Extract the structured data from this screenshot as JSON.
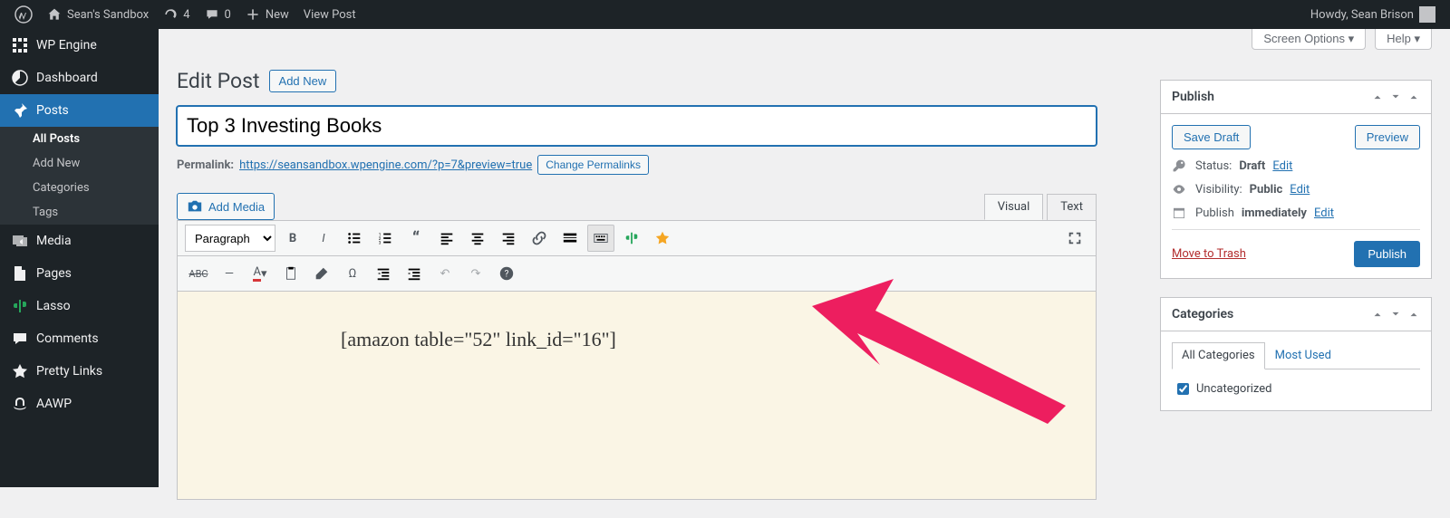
{
  "topbar": {
    "site_name": "Sean's Sandbox",
    "updates_count": "4",
    "comments_count": "0",
    "new_label": "New",
    "view_post_label": "View Post",
    "greeting": "Howdy, Sean Brison"
  },
  "sidebar": {
    "items": [
      {
        "label": "WP Engine",
        "icon": "wpengine-icon"
      },
      {
        "label": "Dashboard",
        "icon": "dashboard-icon"
      },
      {
        "label": "Posts",
        "icon": "pin-icon",
        "active": true
      },
      {
        "label": "Media",
        "icon": "media-icon"
      },
      {
        "label": "Pages",
        "icon": "pages-icon"
      },
      {
        "label": "Lasso",
        "icon": "cactus-icon"
      },
      {
        "label": "Comments",
        "icon": "comment-icon"
      },
      {
        "label": "Pretty Links",
        "icon": "star-icon"
      },
      {
        "label": "AAWP",
        "icon": "amazon-icon"
      }
    ],
    "submenu": [
      {
        "label": "All Posts",
        "active": true
      },
      {
        "label": "Add New"
      },
      {
        "label": "Categories"
      },
      {
        "label": "Tags"
      }
    ]
  },
  "screen_meta": {
    "screen_options_label": "Screen Options",
    "help_label": "Help"
  },
  "heading": {
    "title": "Edit Post",
    "add_new_label": "Add New"
  },
  "post_title": {
    "value": "Top 3 Investing Books"
  },
  "permalink": {
    "label": "Permalink:",
    "url": "https://seansandbox.wpengine.com/?p=7&preview=true",
    "change_label": "Change Permalinks"
  },
  "editor": {
    "add_media_label": "Add Media",
    "tabs": {
      "visual_label": "Visual",
      "text_label": "Text"
    },
    "format_select": "Paragraph",
    "content_text": "[amazon table=\"52\" link_id=\"16\"]"
  },
  "publish_box": {
    "title": "Publish",
    "save_draft_label": "Save Draft",
    "preview_label": "Preview",
    "status_label": "Status:",
    "status_value": "Draft",
    "visibility_label": "Visibility:",
    "visibility_value": "Public",
    "publish_time_label": "Publish",
    "publish_time_value": "immediately",
    "edit_label": "Edit",
    "trash_label": "Move to Trash",
    "publish_button_label": "Publish"
  },
  "categories_box": {
    "title": "Categories",
    "tab_all_label": "All Categories",
    "tab_used_label": "Most Used",
    "items": [
      {
        "label": "Uncategorized",
        "checked": true
      }
    ]
  }
}
